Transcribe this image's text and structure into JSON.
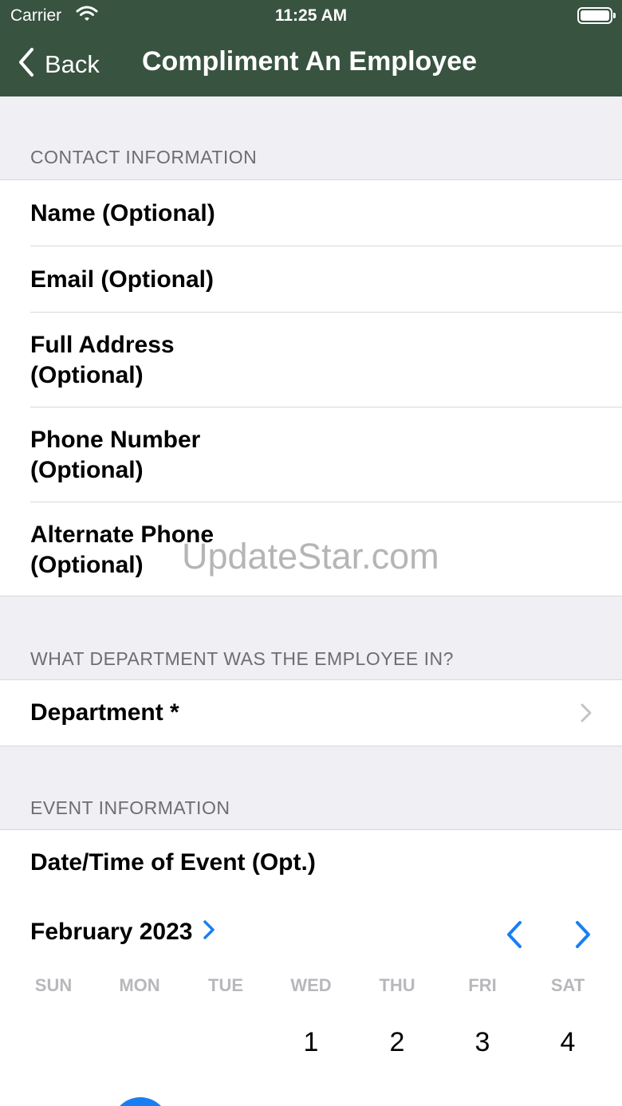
{
  "status_bar": {
    "carrier": "Carrier",
    "time": "11:25 AM"
  },
  "nav": {
    "back_label": "Back",
    "title": "Compliment An Employee"
  },
  "sections": {
    "contact": {
      "header": "CONTACT INFORMATION",
      "fields": {
        "name": "Name (Optional)",
        "email": "Email (Optional)",
        "address_1": "Full Address",
        "address_2": "(Optional)",
        "phone_1": "Phone Number",
        "phone_2": "(Optional)",
        "alt_phone_1": "Alternate Phone",
        "alt_phone_2": "(Optional)"
      }
    },
    "department": {
      "header": "WHAT DEPARTMENT WAS THE EMPLOYEE IN?",
      "label": "Department *"
    },
    "event": {
      "header": "EVENT INFORMATION",
      "date_label": "Date/Time of Event (Opt.)"
    }
  },
  "calendar": {
    "month_label": "February 2023",
    "weekdays": [
      "SUN",
      "MON",
      "TUE",
      "WED",
      "THU",
      "FRI",
      "SAT"
    ],
    "first_week": [
      "",
      "",
      "",
      "1",
      "2",
      "3",
      "4"
    ]
  },
  "watermark": "UpdateStar.com",
  "colors": {
    "nav_bg": "#385340",
    "accent": "#1a7ef2",
    "page_bg": "#efeff4"
  }
}
